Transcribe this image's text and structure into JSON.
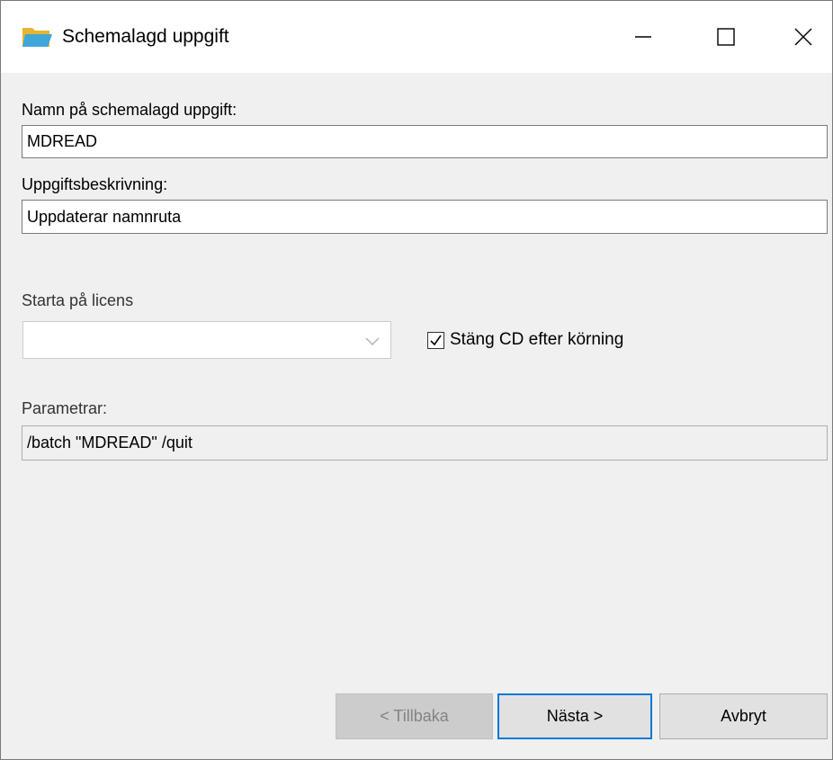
{
  "window": {
    "title": "Schemalagd uppgift",
    "icon": "folder-icon",
    "controls": {
      "minimize": "minimize-icon",
      "maximize": "maximize-icon",
      "close": "close-icon"
    }
  },
  "form": {
    "name_label": "Namn på schemalagd uppgift:",
    "name_value": "MDREAD",
    "description_label": "Uppgiftsbeskrivning:",
    "description_value": "Uppdaterar namnruta",
    "license_label": "Starta på licens",
    "license_value": "",
    "close_cd_label": "Stäng CD efter körning",
    "close_cd_checked": true,
    "parameters_label": "Parametrar:",
    "parameters_value": "/batch \"MDREAD\" /quit"
  },
  "buttons": {
    "back_label": "< Tillbaka",
    "next_label": "Nästa >",
    "cancel_label": "Avbryt"
  },
  "colors": {
    "accent": "#0078d7",
    "folder": "#f5c242",
    "folder_front": "#3fa6d8"
  }
}
